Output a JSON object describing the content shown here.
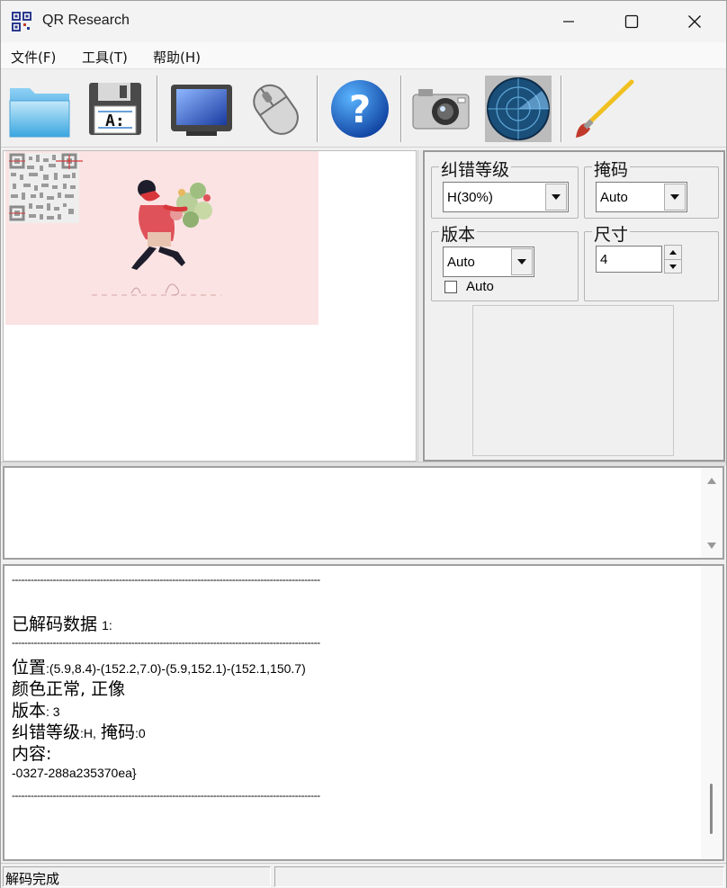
{
  "window": {
    "title": "QR Research",
    "minimize_icon": "minimize-icon",
    "maximize_icon": "maximize-icon",
    "close_icon": "close-icon"
  },
  "menu": {
    "items": [
      {
        "label": "文件(F)"
      },
      {
        "label": "工具(T)"
      },
      {
        "label": "帮助(H)"
      }
    ]
  },
  "toolbar": {
    "buttons": [
      {
        "icon": "folder-open-icon"
      },
      {
        "icon": "save-floppy-icon"
      },
      {
        "icon": "monitor-icon"
      },
      {
        "icon": "mouse-icon"
      },
      {
        "icon": "help-icon"
      },
      {
        "icon": "camera-icon"
      },
      {
        "icon": "radar-scan-icon"
      },
      {
        "icon": "paintbrush-icon"
      }
    ]
  },
  "settings": {
    "ecc_label": "纠错等级",
    "ecc_value": "H(30%)",
    "mask_label": "掩码",
    "mask_value": "Auto",
    "version_label": "版本",
    "version_value": "Auto",
    "auto_check_label": "Auto",
    "auto_checked": false,
    "size_label": "尺寸",
    "size_value": "4"
  },
  "input_text": "",
  "output": {
    "separator": "--------------------------------------------------------------------------------------------------",
    "decoded_label": "已解码数据",
    "decoded_index": "1:",
    "position_label": "位置",
    "position_value": ":(5.9,8.4)-(152.2,7.0)-(5.9,152.1)-(152.1,150.7)",
    "color_line": "颜色正常, 正像",
    "version_label": "版本",
    "version_value": ": 3",
    "ecc_label": "纠错等级",
    "ecc_value": ":H,",
    "mask_label": "掩码",
    "mask_value": ":0",
    "content_label": "内容:",
    "content_value": "-0327-288a235370ea}"
  },
  "status": {
    "text": "解码完成"
  },
  "colors": {
    "image_background": "#fbe3e3",
    "accent": "#1e6fc7"
  }
}
